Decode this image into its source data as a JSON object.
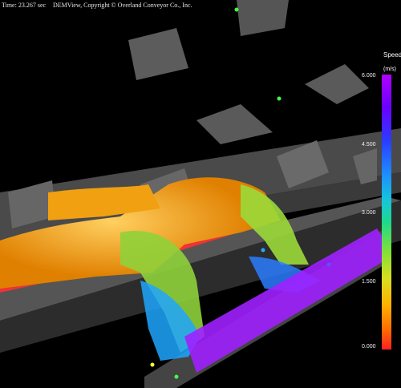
{
  "hud": {
    "time": "Time: 23.267 sec",
    "app_title": "DEMView, Copyright © Overland Conveyor Co., Inc."
  },
  "legend": {
    "title": "Speed",
    "unit": "(m/s)",
    "ticks": [
      "6.000",
      "4.500",
      "3.000",
      "1.500",
      "0.000"
    ],
    "colors": {
      "max": "#b000ff",
      "high": "#2a3cff",
      "mid": "#1fd98a",
      "low": "#ffb000",
      "min": "#ff2020"
    }
  }
}
